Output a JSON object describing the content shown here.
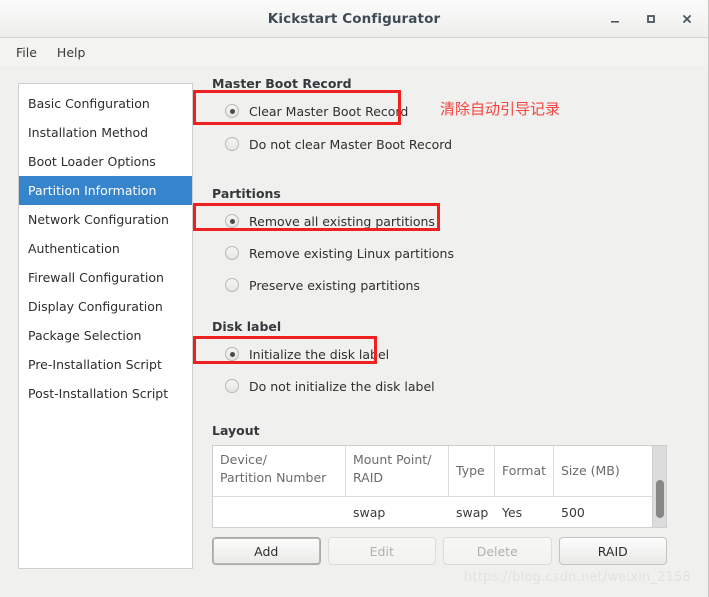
{
  "window": {
    "title": "Kickstart Configurator",
    "controls": [
      {
        "name": "minimize",
        "glyph": "–"
      },
      {
        "name": "maximize",
        "glyph": "□"
      },
      {
        "name": "close",
        "glyph": "✕"
      }
    ]
  },
  "menubar": {
    "items": [
      {
        "label": "File"
      },
      {
        "label": "Help"
      }
    ]
  },
  "sidebar": {
    "items": [
      {
        "label": "Basic Configuration",
        "selected": false
      },
      {
        "label": "Installation Method",
        "selected": false
      },
      {
        "label": "Boot Loader Options",
        "selected": false
      },
      {
        "label": "Partition Information",
        "selected": true
      },
      {
        "label": "Network Configuration",
        "selected": false
      },
      {
        "label": "Authentication",
        "selected": false
      },
      {
        "label": "Firewall Configuration",
        "selected": false
      },
      {
        "label": "Display Configuration",
        "selected": false
      },
      {
        "label": "Package Selection",
        "selected": false
      },
      {
        "label": "Pre-Installation Script",
        "selected": false
      },
      {
        "label": "Post-Installation Script",
        "selected": false
      }
    ]
  },
  "main": {
    "mbr": {
      "title": "Master Boot Record",
      "options": [
        {
          "label": "Clear Master Boot Record",
          "checked": true
        },
        {
          "label": "Do not clear Master Boot Record",
          "checked": false
        }
      ],
      "annotation": "清除自动引导记录"
    },
    "partitions": {
      "title": "Partitions",
      "options": [
        {
          "label": "Remove all existing partitions",
          "checked": true
        },
        {
          "label": "Remove existing Linux partitions",
          "checked": false
        },
        {
          "label": "Preserve existing partitions",
          "checked": false
        }
      ]
    },
    "disk_label": {
      "title": "Disk label",
      "options": [
        {
          "label": "Initialize the disk label",
          "checked": true
        },
        {
          "label": "Do not initialize the disk label",
          "checked": false
        }
      ]
    },
    "layout": {
      "title": "Layout",
      "columns": [
        {
          "line1": "Device/",
          "line2": "Partition Number"
        },
        {
          "line1": "Mount Point/",
          "line2": "RAID"
        },
        {
          "line1": "Type",
          "line2": ""
        },
        {
          "line1": "Format",
          "line2": ""
        },
        {
          "line1": "Size (MB)",
          "line2": ""
        }
      ],
      "rows": [
        {
          "device": "",
          "mount_point": "swap",
          "type": "swap",
          "format": "Yes",
          "size": "500"
        }
      ],
      "buttons": [
        {
          "label": "Add",
          "enabled": true,
          "focused": true
        },
        {
          "label": "Edit",
          "enabled": false,
          "focused": false
        },
        {
          "label": "Delete",
          "enabled": false,
          "focused": false
        },
        {
          "label": "RAID",
          "enabled": true,
          "focused": false
        }
      ]
    }
  },
  "watermark": "https://blog.csdn.net/weixin_2158",
  "colors": {
    "selection_blue": "#3584cc",
    "annotation_red": "#f5433f",
    "highlight_box_red": "#ef2020",
    "window_bg": "#f0f0ef"
  }
}
